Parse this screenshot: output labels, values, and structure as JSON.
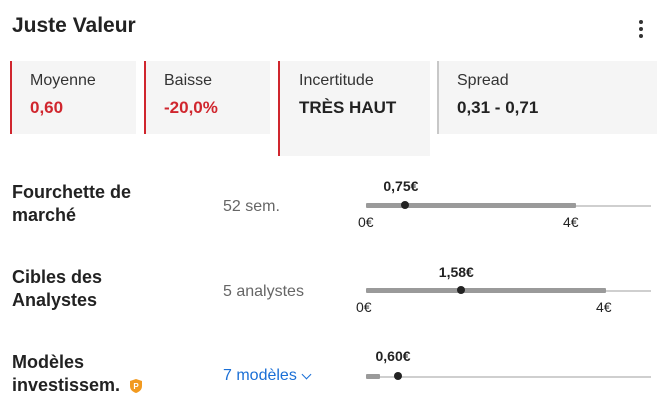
{
  "header": {
    "title": "Juste Valeur",
    "menu_icon": "kebab-menu-icon"
  },
  "cards": [
    {
      "label": "Moyenne",
      "value": "0,60",
      "accent": "#d0262e"
    },
    {
      "label": "Baisse",
      "value": "-20,0%",
      "accent": "#d0262e"
    },
    {
      "label": "Incertitude",
      "value": "TRÈS HAUT",
      "accent": "#d0262e"
    },
    {
      "label": "Spread",
      "value": "0,31 - 0,71",
      "accent": "#c8c8c8"
    }
  ],
  "rows": [
    {
      "label": "Fourchette de marché",
      "meta": "52 sem.",
      "current": "0,75€",
      "min_label": "0€",
      "max_label": "4€",
      "min": 0,
      "max": 4,
      "low": 0,
      "high": 4,
      "value": 0.75
    },
    {
      "label": "Cibles des Analystes",
      "meta": "5 analystes",
      "current": "1,58€",
      "min_label": "0€",
      "max_label": "4€",
      "min": 0,
      "max": 4,
      "low": 0,
      "high": 4,
      "value": 1.58
    },
    {
      "label": "Modèles investissem.",
      "meta": "7 modèles",
      "current": "0,60€",
      "pro_icon": "pro-badge-icon",
      "min": 0,
      "max": 4,
      "value": 0.6
    }
  ],
  "colors": {
    "accent_red": "#d0262e",
    "link_blue": "#1a6fd6",
    "card_bg": "#f5f5f5"
  }
}
